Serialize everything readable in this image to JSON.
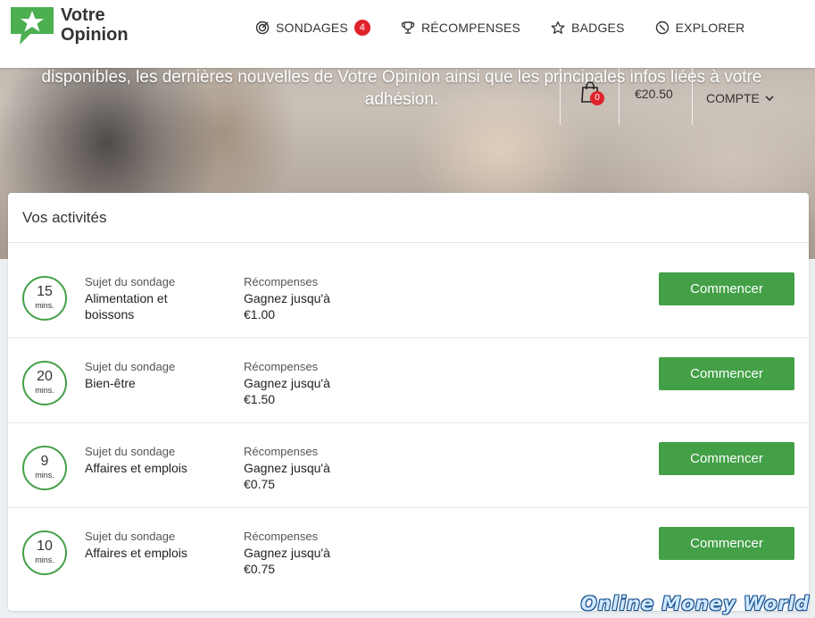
{
  "brand": {
    "line1": "Votre",
    "line2": "Opinion",
    "accent": "#4caf50"
  },
  "nav": [
    {
      "label": "SONDAGES",
      "icon": "target-icon",
      "badge": "4"
    },
    {
      "label": "RÉCOMPENSES",
      "icon": "trophy-icon"
    },
    {
      "label": "BADGES",
      "icon": "star-icon"
    },
    {
      "label": "EXPLORER",
      "icon": "compass-icon"
    }
  ],
  "hero": {
    "text": "disponibles, les dernières nouvelles de Votre Opinion ainsi que les principales infos liées à votre adhésion."
  },
  "account": {
    "cart_count": "0",
    "balance": "€20.50",
    "menu_label": "COMPTE"
  },
  "activities": {
    "title": "Vos activités",
    "subject_label": "Sujet du sondage",
    "reward_label": "Récompenses",
    "button_label": "Commencer",
    "unit": "mins.",
    "items": [
      {
        "minutes": "15",
        "subject": "Alimentation et boissons",
        "reward": "Gagnez jusqu'à €1.00"
      },
      {
        "minutes": "20",
        "subject": "Bien-être",
        "reward": "Gagnez jusqu'à €1.50"
      },
      {
        "minutes": "9",
        "subject": "Affaires et emplois",
        "reward": "Gagnez jusqu'à €0.75"
      },
      {
        "minutes": "10",
        "subject": "Affaires et emplois",
        "reward": "Gagnez jusqu'à €0.75"
      }
    ]
  },
  "watermark": "Online Money World",
  "colors": {
    "primary": "#43a047",
    "badge": "#e0222c"
  }
}
